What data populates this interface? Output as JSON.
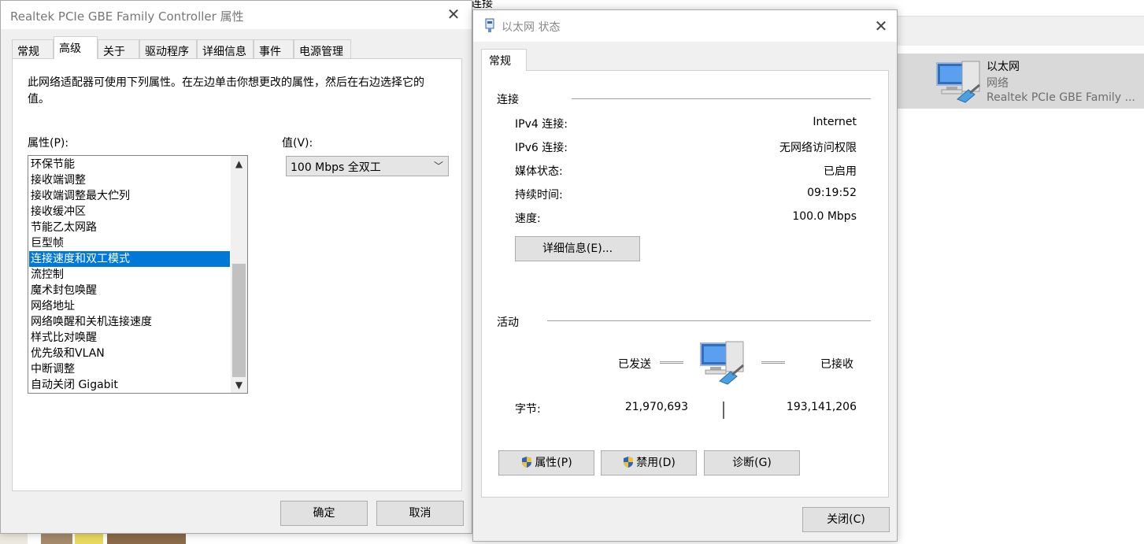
{
  "background": {
    "top_text": "连接",
    "network": {
      "name": "以太网",
      "status": "网络",
      "device": "Realtek PCIe GBE Family ..."
    }
  },
  "properties_dialog": {
    "title": "Realtek PCIe GBE Family Controller 属性",
    "tabs": [
      "常规",
      "高级",
      "关于",
      "驱动程序",
      "详细信息",
      "事件",
      "电源管理"
    ],
    "active_tab": "高级",
    "description": "此网络适配器可使用下列属性。在左边单击你想更改的属性，然后在右边选择它的值。",
    "property_label": "属性(P):",
    "value_label": "值(V):",
    "properties": [
      "环保节能",
      "接收端调整",
      "接收端调整最大伫列",
      "接收缓冲区",
      "节能乙太网路",
      "巨型帧",
      "连接速度和双工模式",
      "流控制",
      "魔术封包唤醒",
      "网络地址",
      "网络唤醒和关机连接速度",
      "样式比对唤醒",
      "优先级和VLAN",
      "中断调整",
      "自动关闭 Gigabit"
    ],
    "selected_property": "连接速度和双工模式",
    "selected_value": "100 Mbps 全双工",
    "ok_label": "确定",
    "cancel_label": "取消"
  },
  "status_dialog": {
    "title": "以太网 状态",
    "tab": "常规",
    "connection_section": "连接",
    "rows": [
      {
        "key": "IPv4 连接:",
        "value": "Internet"
      },
      {
        "key": "IPv6 连接:",
        "value": "无网络访问权限"
      },
      {
        "key": "媒体状态:",
        "value": "已启用"
      },
      {
        "key": "持续时间:",
        "value": "09:19:52"
      },
      {
        "key": "速度:",
        "value": "100.0 Mbps"
      }
    ],
    "details_button": "详细信息(E)...",
    "activity_section": "活动",
    "sent_label": "已发送",
    "received_label": "已接收",
    "bytes_label": "字节:",
    "bytes_sent": "21,970,693",
    "bytes_received": "193,141,206",
    "properties_button": "属性(P)",
    "disable_button": "禁用(D)",
    "diagnose_button": "诊断(G)",
    "close_button": "关闭(C)"
  }
}
